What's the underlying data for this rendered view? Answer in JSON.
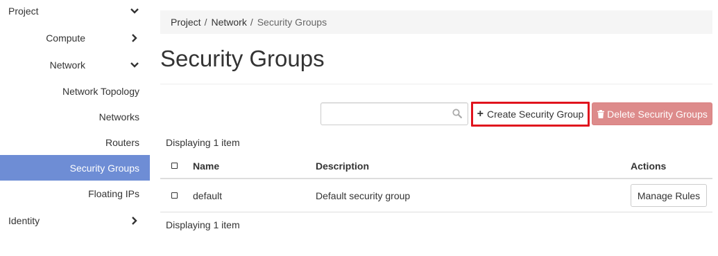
{
  "sidebar": {
    "project": "Project",
    "compute": "Compute",
    "network": "Network",
    "network_topology": "Network Topology",
    "networks": "Networks",
    "routers": "Routers",
    "security_groups": "Security Groups",
    "floating_ips": "Floating IPs",
    "identity": "Identity",
    "active_color": "#6e8dd5"
  },
  "breadcrumb": {
    "project": "Project",
    "network": "Network",
    "current": "Security Groups",
    "separator": "/"
  },
  "page_title": "Security Groups",
  "toolbar": {
    "search_value": "",
    "search_placeholder": "",
    "search_icon": "search-icon",
    "create_label": "Create Security Group",
    "create_icon": "plus-icon",
    "delete_label": "Delete Security Groups",
    "delete_icon": "trash-icon",
    "highlight_color": "#e0131d",
    "delete_color": "#dd8b8b"
  },
  "table": {
    "display_count_top": "Displaying 1 item",
    "display_count_bottom": "Displaying 1 item",
    "columns": {
      "name": "Name",
      "description": "Description",
      "actions": "Actions"
    },
    "rows": [
      {
        "name": "default",
        "description": "Default security group",
        "action": "Manage Rules"
      }
    ]
  }
}
